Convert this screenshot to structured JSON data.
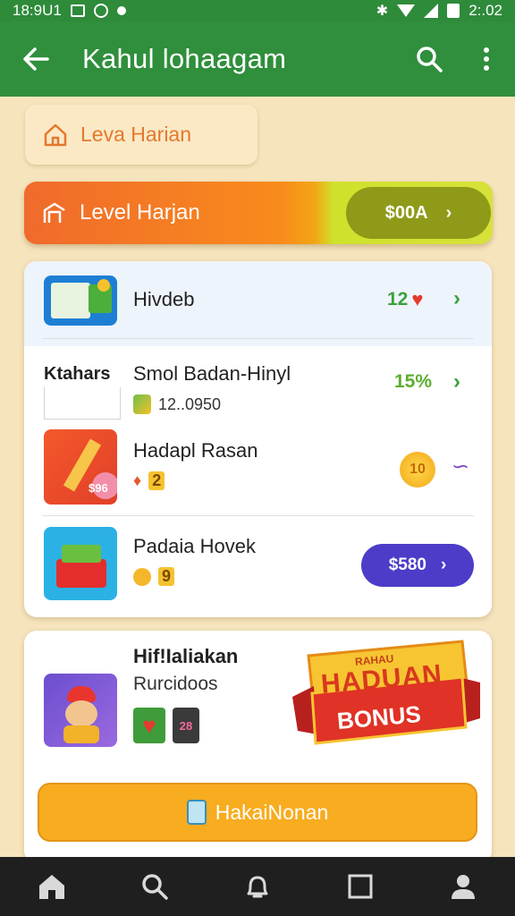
{
  "status_bar": {
    "time": "18:9U1",
    "clock": "2:.02"
  },
  "app_bar": {
    "title": "Kahul lohaagam"
  },
  "chip": {
    "label": "Leva Harian"
  },
  "level_banner": {
    "label": "Level Harjan",
    "pill_value": "$00A"
  },
  "list": {
    "header": {
      "title": "Hivdeb",
      "value": "12"
    },
    "items": [
      {
        "left_label": "Ktahars",
        "title": "Smol Badan-Hinyl",
        "sub": "12..0950",
        "value": "15%"
      },
      {
        "thumb_badge": "$96",
        "title": "Hadapl Rasan",
        "sub": "2",
        "value": "10"
      },
      {
        "title": "Padaia Hovek",
        "sub": "9",
        "button": "$580"
      }
    ]
  },
  "bonus": {
    "title": "Hif!Ialiakan",
    "subtitle": "Rurcidoos",
    "card_value": "28",
    "badge_top": "RAHAU",
    "badge_main": "HADUAN",
    "badge_ribbon": "BONUS",
    "cta": "HakaiNonan"
  },
  "colors": {
    "primary": "#2f8f3c",
    "background": "#f6e4bd",
    "accent_orange": "#f06a2c",
    "accent_purple": "#4c3cc8",
    "cta_yellow": "#f8ac1f"
  }
}
